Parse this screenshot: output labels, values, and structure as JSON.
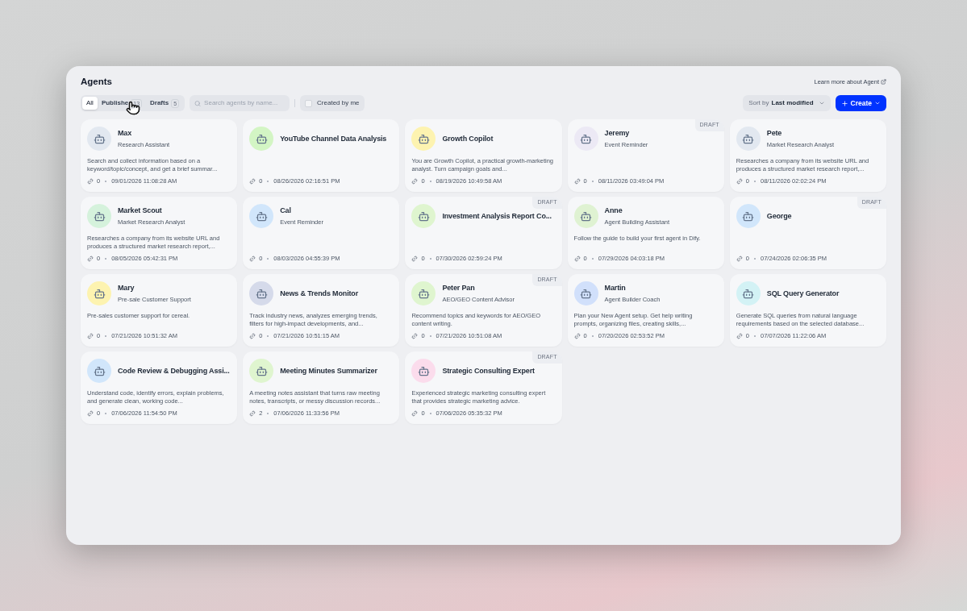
{
  "title": "Agents",
  "learn_more": "Learn more about Agent",
  "tabs": [
    {
      "label": "All",
      "selected": true
    },
    {
      "label": "Publishe",
      "count": "13",
      "selected": false
    },
    {
      "label": "Drafts",
      "count": "5",
      "selected": false
    }
  ],
  "search": {
    "placeholder": "Search agents by name..."
  },
  "created_by_me": {
    "label": "Created by me",
    "checked": false
  },
  "sort": {
    "prefix": "Sort by",
    "value": "Last modified"
  },
  "create_button": {
    "label": "Create"
  },
  "agents": [
    {
      "name": "Max",
      "role": "Research Assistant",
      "description": "Search and collect information based on a keyword/topic/concept, and get a brief summar...",
      "uses": "0",
      "modified": "09/01/2026 11:08:28 AM",
      "color": "#e2e8f0"
    },
    {
      "name": "YouTube Channel Data Analysis",
      "uses": "0",
      "modified": "08/26/2026 02:16:51 PM",
      "color": "#d3f5c4"
    },
    {
      "name": "Growth Copilot",
      "description": "You are Growth Copilot, a practical growth-marketing analyst. Turn campaign goals and...",
      "uses": "0",
      "modified": "08/19/2026 10:49:58 AM",
      "color": "#fdf3b0"
    },
    {
      "name": "Jeremy",
      "role": "Event Reminder",
      "uses": "0",
      "modified": "08/11/2026 03:49:04 PM",
      "badge": "DRAFT",
      "color": "#ece9f5"
    },
    {
      "name": "Pete",
      "role": "Market Research Analyst",
      "description": "Researches a company from its website URL and produces a structured market research report,...",
      "uses": "0",
      "modified": "08/11/2026 02:02:24 PM",
      "color": "#e2e8f0"
    },
    {
      "name": "Market Scout",
      "role": "Market Research Analyst",
      "description": "Researches a company from its website URL and produces a structured market research report,...",
      "uses": "0",
      "modified": "08/05/2026 05:42:31 PM",
      "color": "#d5f2dc"
    },
    {
      "name": "Cal",
      "role": "Event Reminder",
      "uses": "0",
      "modified": "08/03/2026 04:55:39 PM",
      "color": "#d1e6fb"
    },
    {
      "name": "Investment Analysis Report Co...",
      "uses": "0",
      "modified": "07/30/2026 02:59:24 PM",
      "badge": "DRAFT",
      "color": "#dff5cf"
    },
    {
      "name": "Anne",
      "role": "Agent Building Assistant",
      "description": "Follow the guide to build your first agent in Dify.",
      "uses": "0",
      "modified": "07/29/2026 04:03:18 PM",
      "color": "#dff2d2"
    },
    {
      "name": "George",
      "uses": "0",
      "modified": "07/24/2026 02:06:35 PM",
      "badge": "DRAFT",
      "color": "#d1e6fb"
    },
    {
      "name": "Mary",
      "role": "Pre-sale Customer Support",
      "description": "Pre-sales customer support for cereal.",
      "uses": "0",
      "modified": "07/21/2026 10:51:32 AM",
      "color": "#fdf3b0"
    },
    {
      "name": "News & Trends Monitor",
      "description": "Track industry news, analyzes emerging trends, filters for high-impact developments, and...",
      "uses": "0",
      "modified": "07/21/2026 10:51:15 AM",
      "color": "#d5daea"
    },
    {
      "name": "Peter Pan",
      "role": "AEO/GEO Content Advisor",
      "description": "Recommend topics and keywords for AEO/GEO content writing.",
      "uses": "0",
      "modified": "07/21/2026 10:51:08 AM",
      "badge": "DRAFT",
      "color": "#dff5cf"
    },
    {
      "name": "Martin",
      "role": "Agent Builder Coach",
      "description": "Plan your New Agent setup. Get help writing prompts, organizing files, creating skills,...",
      "uses": "0",
      "modified": "07/20/2026 02:53:52 PM",
      "color": "#d1e0fb"
    },
    {
      "name": "SQL Query Generator",
      "description": "Generate SQL queries from natural language requirements based on the selected database...",
      "uses": "0",
      "modified": "07/07/2026 11:22:06 AM",
      "color": "#d3f2f5"
    },
    {
      "name": "Code Review & Debugging Assi...",
      "description": "Understand code, identify errors, explain problems, and generate clean, working code...",
      "uses": "0",
      "modified": "07/06/2026 11:54:50 PM",
      "color": "#d1e6fb"
    },
    {
      "name": "Meeting Minutes Summarizer",
      "description": "A meeting notes assistant that turns raw meeting notes, transcripts, or messy discussion records...",
      "uses": "2",
      "modified": "07/06/2026 11:33:56 PM",
      "color": "#dff5cf"
    },
    {
      "name": "Strategic Consulting Expert",
      "description": "Experienced strategic marketing consulting expert that provides strategic marketing advice.",
      "uses": "0",
      "modified": "07/06/2026 05:35:32 PM",
      "badge": "DRAFT",
      "color": "#fbdcec"
    }
  ]
}
